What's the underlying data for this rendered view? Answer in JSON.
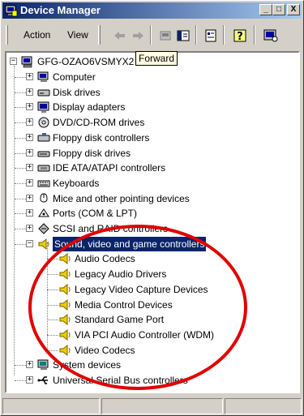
{
  "window": {
    "title": "Device Manager",
    "minimize_label": "_",
    "maximize_label": "□",
    "close_label": "X"
  },
  "menu": {
    "action_label": "Action",
    "view_label": "View"
  },
  "tooltip": "Forward",
  "tree": {
    "root": "GFG-OZAO6VSMYX2",
    "categories": [
      "Computer",
      "Disk drives",
      "Display adapters",
      "DVD/CD-ROM drives",
      "Floppy disk controllers",
      "Floppy disk drives",
      "IDE ATA/ATAPI controllers",
      "Keyboards",
      "Mice and other pointing devices",
      "Ports (COM & LPT)",
      "SCSI and RAID controllers",
      "Sound, video and game controllers"
    ],
    "sound_children": [
      "Audio Codecs",
      "Legacy Audio Drivers",
      "Legacy Video Capture Devices",
      "Media Control Devices",
      "Standard Game Port",
      "VIA PCI Audio Controller (WDM)",
      "Video Codecs"
    ],
    "after": [
      "System devices",
      "Universal Serial Bus controllers"
    ]
  },
  "annotation": {
    "color": "#e00000"
  },
  "colors": {
    "title_start": "#0a246a",
    "title_end": "#a6caf0",
    "selection": "#0a246a"
  }
}
